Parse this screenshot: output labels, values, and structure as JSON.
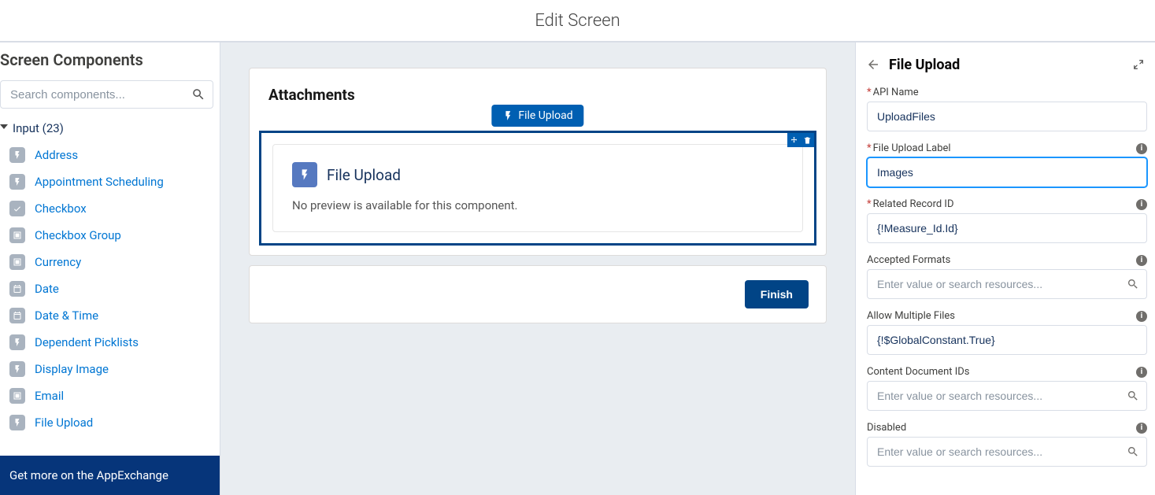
{
  "header": {
    "title": "Edit Screen"
  },
  "left": {
    "title": "Screen Components",
    "searchPlaceholder": "Search components...",
    "section": "Input (23)",
    "components": [
      {
        "label": "Address",
        "icon": "bolt"
      },
      {
        "label": "Appointment Scheduling",
        "icon": "bolt"
      },
      {
        "label": "Checkbox",
        "icon": "check"
      },
      {
        "label": "Checkbox Group",
        "icon": "square"
      },
      {
        "label": "Currency",
        "icon": "square"
      },
      {
        "label": "Date",
        "icon": "calendar"
      },
      {
        "label": "Date & Time",
        "icon": "calendar"
      },
      {
        "label": "Dependent Picklists",
        "icon": "bolt"
      },
      {
        "label": "Display Image",
        "icon": "bolt"
      },
      {
        "label": "Email",
        "icon": "square"
      },
      {
        "label": "File Upload",
        "icon": "bolt"
      }
    ],
    "footer": "Get more on the AppExchange"
  },
  "canvas": {
    "sectionTitle": "Attachments",
    "badge": "File Upload",
    "componentTitle": "File Upload",
    "componentDesc": "No preview is available for this component.",
    "finish": "Finish"
  },
  "props": {
    "title": "File Upload",
    "fields": [
      {
        "label": "API Name",
        "required": true,
        "value": "UploadFiles",
        "info": false,
        "search": false,
        "focused": false,
        "placeholder": ""
      },
      {
        "label": "File Upload Label",
        "required": true,
        "value": "Images",
        "info": true,
        "search": false,
        "focused": true,
        "placeholder": ""
      },
      {
        "label": "Related Record ID",
        "required": true,
        "value": "{!Measure_Id.Id}",
        "info": true,
        "search": false,
        "focused": false,
        "placeholder": ""
      },
      {
        "label": "Accepted Formats",
        "required": false,
        "value": "",
        "info": true,
        "search": true,
        "focused": false,
        "placeholder": "Enter value or search resources..."
      },
      {
        "label": "Allow Multiple Files",
        "required": false,
        "value": "{!$GlobalConstant.True}",
        "info": true,
        "search": false,
        "focused": false,
        "placeholder": ""
      },
      {
        "label": "Content Document IDs",
        "required": false,
        "value": "",
        "info": true,
        "search": true,
        "focused": false,
        "placeholder": "Enter value or search resources..."
      },
      {
        "label": "Disabled",
        "required": false,
        "value": "",
        "info": true,
        "search": true,
        "focused": false,
        "placeholder": "Enter value or search resources..."
      }
    ]
  }
}
